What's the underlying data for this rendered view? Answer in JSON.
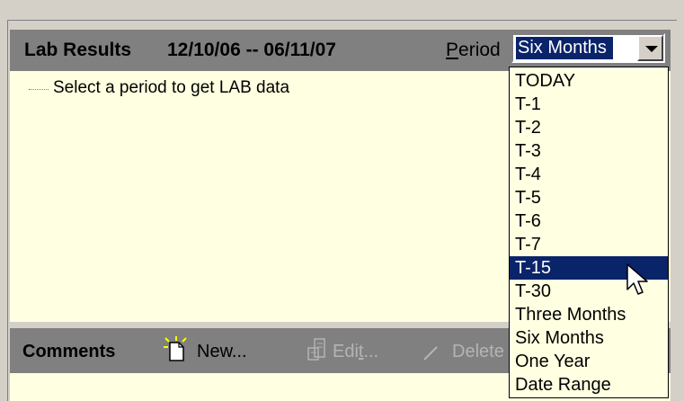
{
  "lab_results": {
    "title": "Lab Results",
    "date_range": "12/10/06 -- 06/11/07",
    "period_label_mnemonic": "P",
    "period_label_rest": "eriod",
    "period_value": "Six Months",
    "tree_item": "Select a period to get LAB data"
  },
  "period_options": [
    "TODAY",
    "T-1",
    "T-2",
    "T-3",
    "T-4",
    "T-5",
    "T-6",
    "T-7",
    "T-15",
    "T-30",
    "Three Months",
    "Six Months",
    "One Year",
    "Date Range"
  ],
  "highlighted_option": "T-15",
  "comments": {
    "title": "Comments",
    "new_label": "New...",
    "edit_label_prefix": "Edi",
    "edit_label_mnemonic": "t",
    "edit_label_suffix": "...",
    "delete_label": "Delete"
  },
  "colors": {
    "header_bg": "#808080",
    "content_bg": "#ffffe1",
    "selection": "#0a246a",
    "disabled_text": "#b4b4b4"
  },
  "icons": {
    "new": "new-document-icon",
    "edit": "edit-document-icon",
    "delete": "delete-icon",
    "dropdown": "chevron-down-icon",
    "cursor": "mouse-pointer-icon"
  }
}
